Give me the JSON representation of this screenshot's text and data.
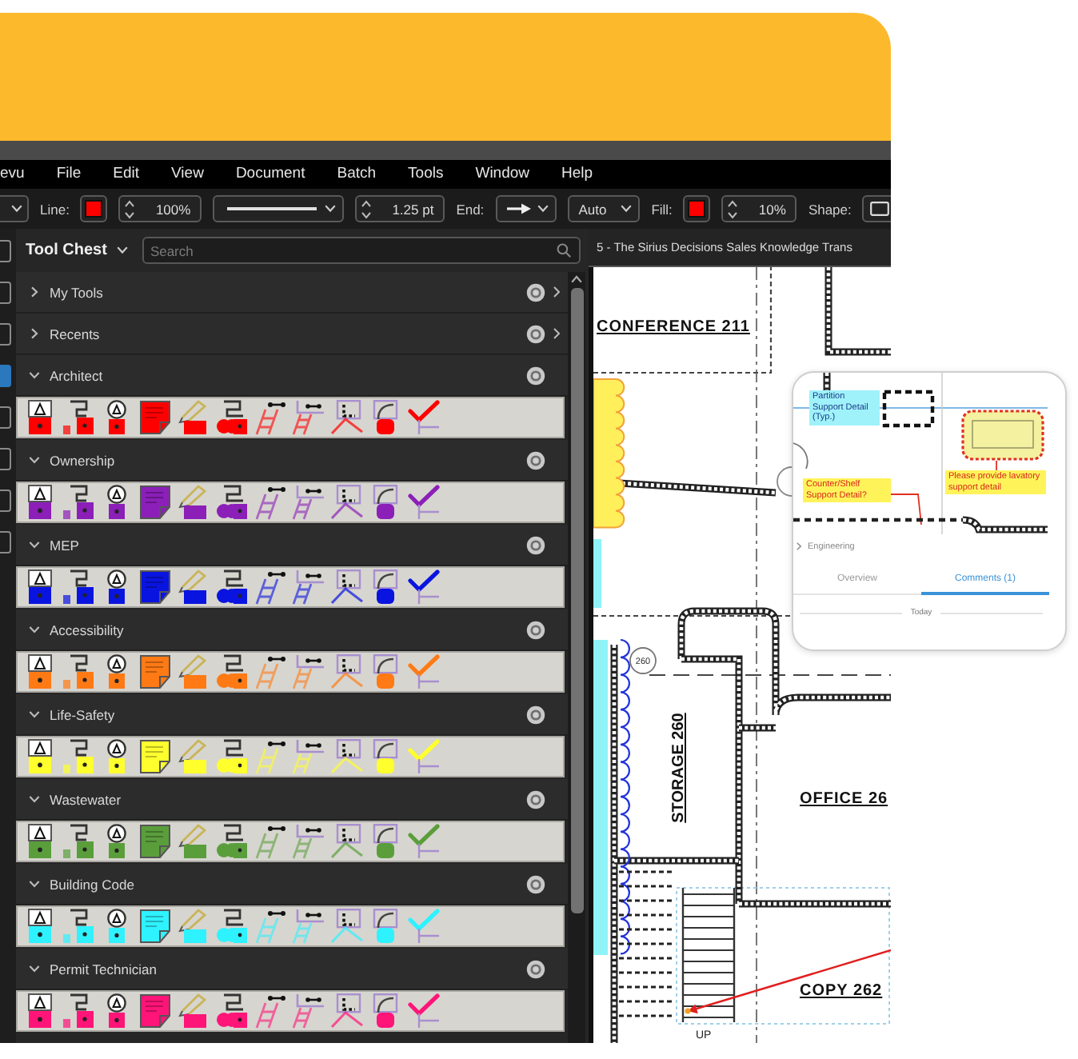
{
  "menu": [
    {
      "label": "evu"
    },
    {
      "label": "File"
    },
    {
      "label": "Edit"
    },
    {
      "label": "View"
    },
    {
      "label": "Document"
    },
    {
      "label": "Batch"
    },
    {
      "label": "Tools"
    },
    {
      "label": "Window"
    },
    {
      "label": "Help"
    }
  ],
  "toolbar": [
    {
      "kind": "icon-dropdown"
    },
    {
      "kind": "label",
      "text": "Line:"
    },
    {
      "kind": "swatch",
      "color": "#ff0000"
    },
    {
      "kind": "spinner",
      "value": "100%"
    },
    {
      "kind": "line-dropdown"
    },
    {
      "kind": "spinner",
      "value": "1.25 pt"
    },
    {
      "kind": "label",
      "text": "End:"
    },
    {
      "kind": "arrow-dropdown"
    },
    {
      "kind": "text-dropdown",
      "value": "Auto"
    },
    {
      "kind": "label",
      "text": "Fill:"
    },
    {
      "kind": "swatch",
      "color": "#ff0000"
    },
    {
      "kind": "spinner",
      "value": "10%"
    },
    {
      "kind": "label",
      "text": "Shape:"
    },
    {
      "kind": "shape-dropdown"
    }
  ],
  "side_tools": [
    {
      "selected": false
    },
    {
      "selected": false
    },
    {
      "selected": false
    },
    {
      "selected": true
    },
    {
      "selected": false
    },
    {
      "selected": false
    },
    {
      "selected": false
    },
    {
      "selected": false
    }
  ],
  "tool_chest": {
    "title": "Tool Chest",
    "search": {
      "placeholder": "Search"
    },
    "sections": [
      {
        "title": "My Tools",
        "expanded": false
      },
      {
        "title": "Recents",
        "expanded": false
      },
      {
        "title": "Architect",
        "expanded": true,
        "color": "#ff0000"
      },
      {
        "title": "Ownership",
        "expanded": true,
        "color": "#8b1fb8"
      },
      {
        "title": "MEP",
        "expanded": true,
        "color": "#0a14e0"
      },
      {
        "title": "Accessibility",
        "expanded": true,
        "color": "#ff7a14"
      },
      {
        "title": "Life-Safety",
        "expanded": true,
        "color": "#ffff2e"
      },
      {
        "title": "Wastewater",
        "expanded": true,
        "color": "#5a9e3c"
      },
      {
        "title": "Building Code",
        "expanded": true,
        "color": "#2ef2ff"
      },
      {
        "title": "Permit Technician",
        "expanded": true,
        "color": "#ff1478"
      }
    ]
  },
  "document": {
    "tab": "5 - The Sirius Decisions Sales Knowledge Trans",
    "rooms": [
      {
        "name": "CONFERENCE 211"
      },
      {
        "name": "STORAGE 260"
      },
      {
        "name": "OFFICE 26"
      },
      {
        "name": "COPY 262"
      }
    ],
    "tag": "260",
    "stair_label": "UP"
  },
  "preview": {
    "markups": [
      {
        "kind": "tag",
        "text": "Partition Support Detail (Typ.)"
      },
      {
        "kind": "comment",
        "text": "Counter/Shelf Support Detail?"
      },
      {
        "kind": "comment",
        "text": "Please provide lavatory support detail"
      }
    ],
    "group": "Engineering",
    "tabs": [
      {
        "label": "Overview",
        "selected": false
      },
      {
        "label": "Comments (1)",
        "selected": true
      }
    ],
    "day": "Today"
  }
}
